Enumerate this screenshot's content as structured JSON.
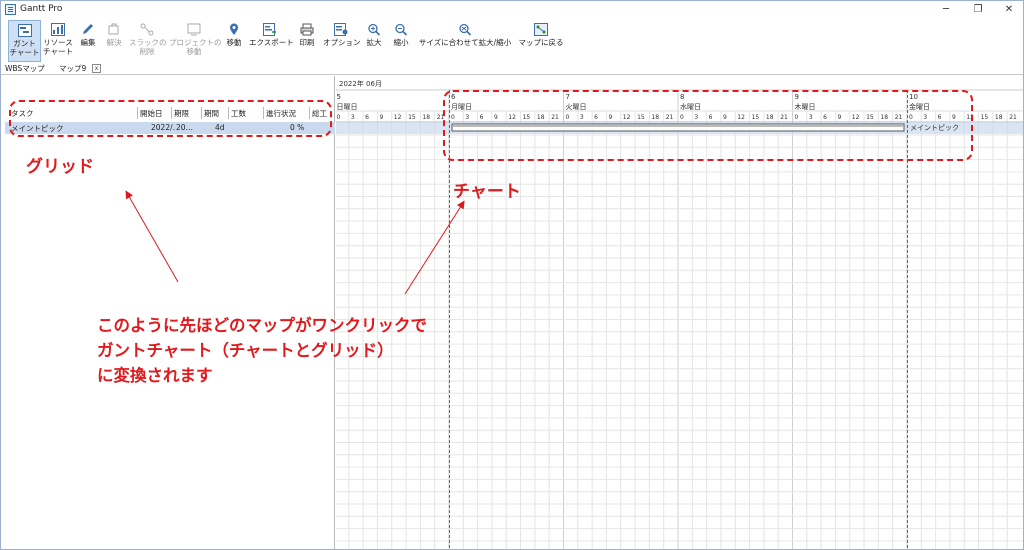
{
  "window": {
    "title": "Gantt Pro",
    "minimize": "─",
    "restore": "❐",
    "close": "✕"
  },
  "toolbar": {
    "items": [
      {
        "line1": "ガント",
        "line2": "チャート",
        "icon": "gantt-chart-icon",
        "active": true,
        "enabled": true
      },
      {
        "line1": "リソース",
        "line2": "チャート",
        "icon": "resource-chart-icon",
        "enabled": true
      },
      {
        "line1": "編集",
        "line2": "",
        "icon": "pencil-icon",
        "enabled": true
      },
      {
        "line1": "解決",
        "line2": "",
        "icon": "resolve-icon",
        "enabled": false
      },
      {
        "line1": "スラックの",
        "line2": "削除",
        "icon": "slack-delete-icon",
        "enabled": false
      },
      {
        "line1": "プロジェクトの",
        "line2": "移動",
        "icon": "project-move-icon",
        "enabled": false
      },
      {
        "line1": "移動",
        "line2": "",
        "icon": "location-pin-icon",
        "enabled": true
      },
      {
        "line1": "エクスポート",
        "line2": "",
        "icon": "export-icon",
        "enabled": true
      },
      {
        "line1": "印刷",
        "line2": "",
        "icon": "printer-icon",
        "enabled": true
      },
      {
        "line1": "オプション",
        "line2": "",
        "icon": "options-icon",
        "enabled": true
      },
      {
        "line1": "拡大",
        "line2": "",
        "icon": "zoom-in-icon",
        "enabled": true
      },
      {
        "line1": "縮小",
        "line2": "",
        "icon": "zoom-out-icon",
        "enabled": true
      },
      {
        "line1": "サイズに合わせて拡大/縮小",
        "line2": "",
        "icon": "zoom-fit-icon",
        "enabled": true
      },
      {
        "line1": "マップに戻る",
        "line2": "",
        "icon": "back-to-map-icon",
        "enabled": true
      }
    ]
  },
  "tabs": {
    "wbs": "WBSマップ",
    "map": "マップ9",
    "close": "x"
  },
  "grid": {
    "columns": [
      "タスク",
      "開始日",
      "期限",
      "期間",
      "工数",
      "進行状況",
      "総工"
    ],
    "row": {
      "task": "メイントピック",
      "start": "2022/…",
      "due": "20…",
      "duration": "4d",
      "effort": "",
      "progress": "0 %",
      "total": ""
    }
  },
  "chart": {
    "month": "2022年 06月",
    "days": [
      {
        "num": "5",
        "name": "日曜日"
      },
      {
        "num": "6",
        "name": "月曜日"
      },
      {
        "num": "7",
        "name": "火曜日"
      },
      {
        "num": "8",
        "name": "水曜日"
      },
      {
        "num": "9",
        "name": "木曜日"
      },
      {
        "num": "10",
        "name": "金曜日"
      }
    ],
    "hours": [
      "0",
      "3",
      "6",
      "9",
      "12",
      "15",
      "18",
      "21"
    ],
    "bar_label": "メイントピック",
    "accent": "#4a5fd0"
  },
  "annotations": {
    "grid_label": "グリッド",
    "chart_label": "チャート",
    "message_lines": [
      "このように先ほどのマップがワンクリックで",
      "ガントチャート（チャートとグリッド）",
      "に変換されます"
    ],
    "color": "#e0191c"
  }
}
